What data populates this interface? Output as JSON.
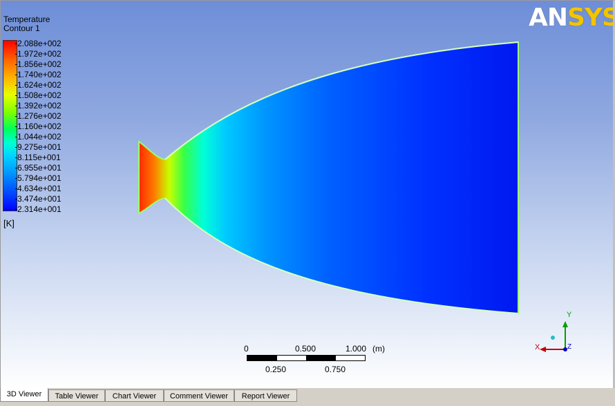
{
  "legend": {
    "title": "Temperature",
    "subtitle": "Contour 1",
    "ticks": [
      "2.088e+002",
      "1.972e+002",
      "1.856e+002",
      "1.740e+002",
      "1.624e+002",
      "1.508e+002",
      "1.392e+002",
      "1.276e+002",
      "1.160e+002",
      "1.044e+002",
      "9.275e+001",
      "8.115e+001",
      "6.955e+001",
      "5.794e+001",
      "4.634e+001",
      "3.474e+001",
      "2.314e+001"
    ],
    "unit": "[K]"
  },
  "logo": {
    "part1": "AN",
    "part2": "SYS"
  },
  "scale": {
    "top_labels": [
      "0",
      "0.500",
      "1.000"
    ],
    "unit": "(m)",
    "bottom_labels": [
      "0.250",
      "0.750"
    ]
  },
  "axes": {
    "x": "X",
    "y": "Y",
    "z": "Z",
    "x_color": "#c00000",
    "y_color": "#00a000",
    "z_color": "#0000c0"
  },
  "tabs": [
    "3D Viewer",
    "Table Viewer",
    "Chart Viewer",
    "Comment Viewer",
    "Report Viewer"
  ],
  "active_tab": "3D Viewer"
}
